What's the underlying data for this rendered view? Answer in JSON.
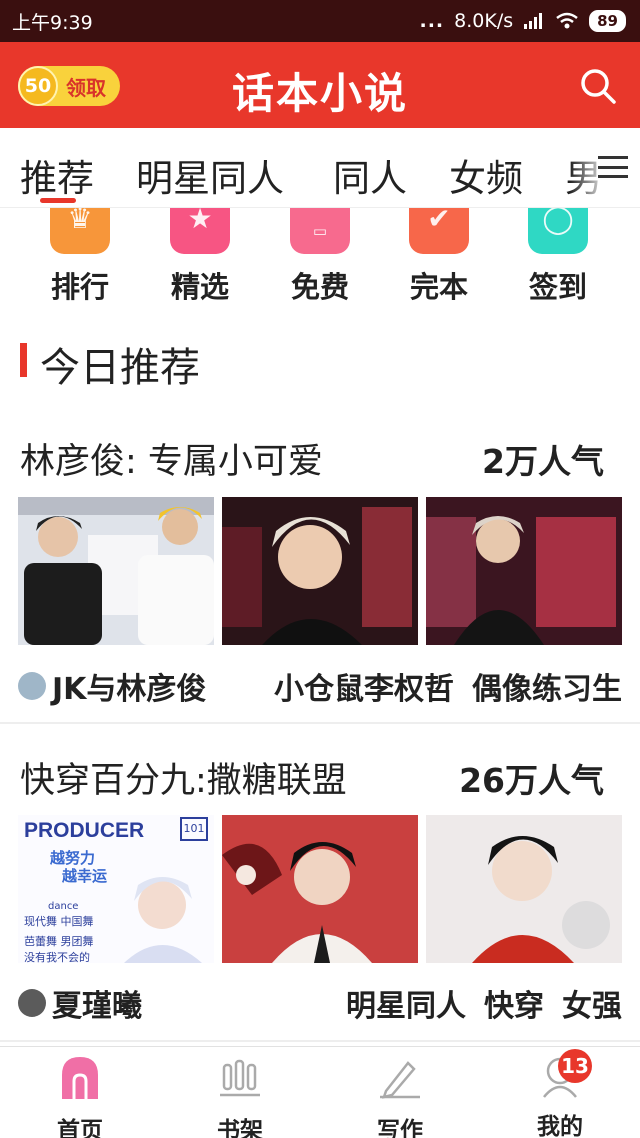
{
  "status_bar": {
    "time": "上午9:39",
    "dots": "...",
    "network_speed": "8.0K/s",
    "battery": "89"
  },
  "header": {
    "coin_count": "50",
    "coin_label": "领取",
    "title": "话本小说",
    "search_icon": "search-icon"
  },
  "tabs": [
    {
      "label": "推荐",
      "active": true
    },
    {
      "label": "明星同人"
    },
    {
      "label": "同人"
    },
    {
      "label": "女频"
    },
    {
      "label": "男"
    }
  ],
  "categories": [
    {
      "label": "排行",
      "icon": "trophy-icon",
      "color": "#f7963a"
    },
    {
      "label": "精选",
      "icon": "star-icon",
      "color": "#f75583"
    },
    {
      "label": "免费",
      "icon": "free-icon",
      "color": "#f76a8e"
    },
    {
      "label": "完本",
      "icon": "check-icon",
      "color": "#f7674a"
    },
    {
      "label": "签到",
      "icon": "signin-icon",
      "color": "#2fd8c4"
    }
  ],
  "section": {
    "title": "今日推荐"
  },
  "books": [
    {
      "title": "林彦俊: 专属小可爱",
      "popularity": "2万人气",
      "author": "JK与林彦俊",
      "tags": [
        "小仓鼠李权哲",
        "偶像练习生"
      ]
    },
    {
      "title": "快穿百分九:撒糖联盟",
      "popularity": "26万人气",
      "author": "夏瑾曦",
      "tags": [
        "明星同人",
        "快穿",
        "女强"
      ],
      "cover_text": {
        "producer": "PRODUCER",
        "logo": "101",
        "slogan1": "越努力",
        "slogan2": "越幸运",
        "lines": [
          "dance",
          "现代舞 中国舞",
          "芭蕾舞 男团舞",
          "没有我不会的"
        ]
      }
    }
  ],
  "bottom_nav": [
    {
      "label": "首页",
      "icon": "home-icon",
      "active": true
    },
    {
      "label": "书架",
      "icon": "bookshelf-icon"
    },
    {
      "label": "写作",
      "icon": "pen-icon"
    },
    {
      "label": "我的",
      "icon": "profile-icon",
      "badge": "13"
    }
  ],
  "colors": {
    "brand_red": "#e8372b",
    "status_bar": "#3a0f0f",
    "coin_yellow": "#f9d23c"
  }
}
